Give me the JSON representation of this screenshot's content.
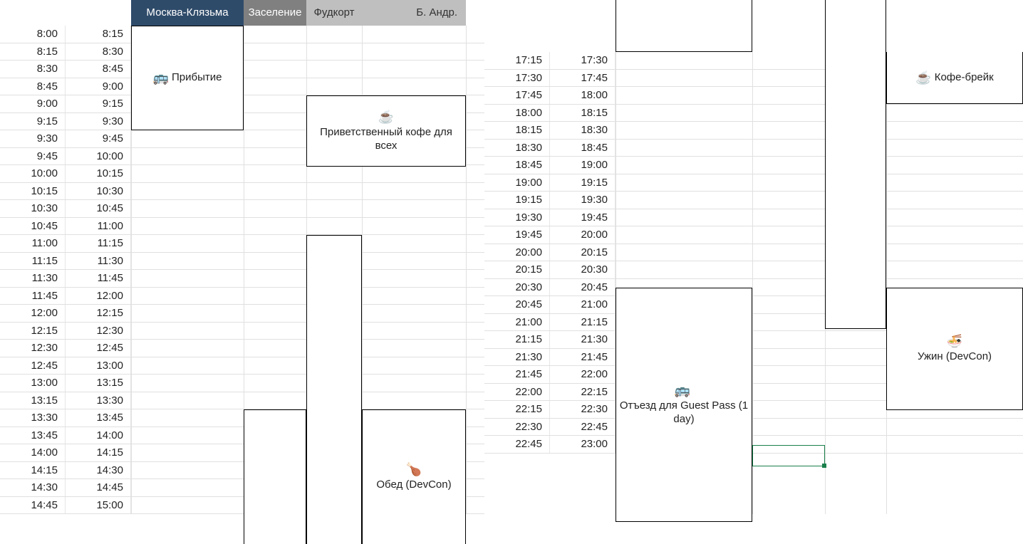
{
  "headers": {
    "col1": "Москва-Клязьма",
    "col2": "Заселение",
    "col3": "Фудкорт",
    "col4": "Б. Андр."
  },
  "left_times": [
    [
      "8:00",
      "8:15"
    ],
    [
      "8:15",
      "8:30"
    ],
    [
      "8:30",
      "8:45"
    ],
    [
      "8:45",
      "9:00"
    ],
    [
      "9:00",
      "9:15"
    ],
    [
      "9:15",
      "9:30"
    ],
    [
      "9:30",
      "9:45"
    ],
    [
      "9:45",
      "10:00"
    ],
    [
      "10:00",
      "10:15"
    ],
    [
      "10:15",
      "10:30"
    ],
    [
      "10:30",
      "10:45"
    ],
    [
      "10:45",
      "11:00"
    ],
    [
      "11:00",
      "11:15"
    ],
    [
      "11:15",
      "11:30"
    ],
    [
      "11:30",
      "11:45"
    ],
    [
      "11:45",
      "12:00"
    ],
    [
      "12:00",
      "12:15"
    ],
    [
      "12:15",
      "12:30"
    ],
    [
      "12:30",
      "12:45"
    ],
    [
      "12:45",
      "13:00"
    ],
    [
      "13:00",
      "13:15"
    ],
    [
      "13:15",
      "13:30"
    ],
    [
      "13:30",
      "13:45"
    ],
    [
      "13:45",
      "14:00"
    ],
    [
      "14:00",
      "14:15"
    ],
    [
      "14:15",
      "14:30"
    ],
    [
      "14:30",
      "14:45"
    ],
    [
      "14:45",
      "15:00"
    ]
  ],
  "right_times": [
    [
      "17:15",
      "17:30"
    ],
    [
      "17:30",
      "17:45"
    ],
    [
      "17:45",
      "18:00"
    ],
    [
      "18:00",
      "18:15"
    ],
    [
      "18:15",
      "18:30"
    ],
    [
      "18:30",
      "18:45"
    ],
    [
      "18:45",
      "19:00"
    ],
    [
      "19:00",
      "19:15"
    ],
    [
      "19:15",
      "19:30"
    ],
    [
      "19:30",
      "19:45"
    ],
    [
      "19:45",
      "20:00"
    ],
    [
      "20:00",
      "20:15"
    ],
    [
      "20:15",
      "20:30"
    ],
    [
      "20:30",
      "20:45"
    ],
    [
      "20:45",
      "21:00"
    ],
    [
      "21:00",
      "21:15"
    ],
    [
      "21:15",
      "21:30"
    ],
    [
      "21:30",
      "21:45"
    ],
    [
      "21:45",
      "22:00"
    ],
    [
      "22:00",
      "22:15"
    ],
    [
      "22:15",
      "22:30"
    ],
    [
      "22:30",
      "22:45"
    ],
    [
      "22:45",
      "23:00"
    ]
  ],
  "events": {
    "arrival": {
      "icon": "🚌",
      "label": "Прибытие"
    },
    "welcome_coffee": {
      "icon": "☕",
      "label": "Приветственный кофе для всех"
    },
    "lunch": {
      "icon": "🍗",
      "label": "Обед (DevCon)"
    },
    "coffee_break": {
      "icon": "☕",
      "label": "Кофе-брейк"
    },
    "departure": {
      "icon": "🚌",
      "label": "Отъезд для Guest Pass (1 day)"
    },
    "dinner": {
      "icon": "🍜",
      "label": "Ужин (DevCon)"
    }
  }
}
